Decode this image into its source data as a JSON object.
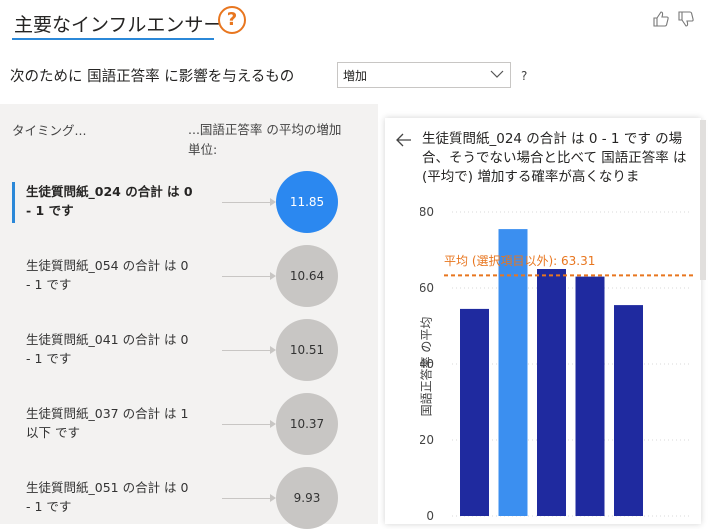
{
  "header": {
    "title": "主要なインフルエンサー",
    "help_glyph": "?",
    "explain_prefix": "次のために 国語正答率 に影響を与えるもの",
    "dropdown_value": "増加",
    "question": "?"
  },
  "left": {
    "col_timing": "タイミング...",
    "col_effect": "...国語正答率 の平均の増加\n単位:",
    "influencers": [
      {
        "label_line1": "生徒質問紙_024 の合計 は 0",
        "label_line2": "- 1 です",
        "value": "11.85",
        "selected": true
      },
      {
        "label_line1": "生徒質問紙_054 の合計 は 0",
        "label_line2": "- 1 です",
        "value": "10.64",
        "selected": false
      },
      {
        "label_line1": "生徒質問紙_041 の合計 は 0",
        "label_line2": "- 1 です",
        "value": "10.51",
        "selected": false
      },
      {
        "label_line1": "生徒質問紙_037 の合計 は 1",
        "label_line2": "以下 です",
        "value": "10.37",
        "selected": false
      },
      {
        "label_line1": "生徒質問紙_051 の合計 は 0",
        "label_line2": "- 1 です",
        "value": "9.93",
        "selected": false
      }
    ]
  },
  "detail": {
    "description": "生徒質問紙_024 の合計 は 0 - 1 です の場合、そうでない場合と比べて 国語正答率 は (平均で) 増加する確率が高くなりま",
    "ylabel": "国語正答率 の平均",
    "avg_label": "平均 (選択項目以外): 63.31"
  },
  "chart_data": {
    "type": "bar",
    "ylabel": "国語正答率 の平均",
    "ylim": [
      0,
      80
    ],
    "yticks": [
      0,
      20,
      40,
      60,
      80
    ],
    "values": [
      54.5,
      75.5,
      65,
      63,
      55.5
    ],
    "highlight_index": 1,
    "avg_line": 63.31,
    "colors": {
      "bar": "#1f2a9f",
      "highlight": "#3b8ff0",
      "avg": "#e8761f"
    }
  },
  "colors": {
    "accent": "#2b88d8",
    "help": "#e8761f",
    "bubble_selected": "#2b88f0",
    "bubble": "#c8c6c4"
  }
}
